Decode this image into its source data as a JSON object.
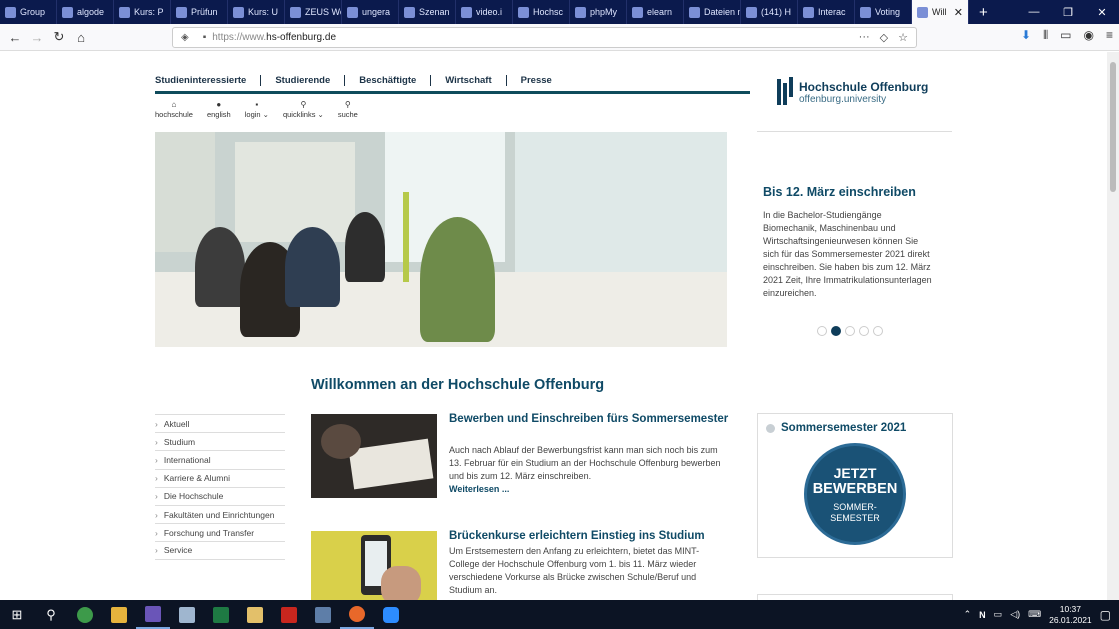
{
  "browser": {
    "tabs": [
      {
        "label": "Group"
      },
      {
        "label": "algode"
      },
      {
        "label": "Kurs: P"
      },
      {
        "label": "Prüfun"
      },
      {
        "label": "Kurs: U"
      },
      {
        "label": "ZEUS Web"
      },
      {
        "label": "ungera"
      },
      {
        "label": "Szenan"
      },
      {
        "label": "video.i"
      },
      {
        "label": "Hochsc"
      },
      {
        "label": "phpMy"
      },
      {
        "label": "elearn"
      },
      {
        "label": "Dateien m"
      },
      {
        "label": "(141) H"
      },
      {
        "label": "Interac"
      },
      {
        "label": "Voting"
      },
      {
        "label": "Will"
      }
    ],
    "new_tab": "+",
    "url_prefix": "https://www.",
    "url_host": "hs-offenburg.de"
  },
  "site": {
    "topnav": [
      "Studieninteressierte",
      "Studierende",
      "Beschäftigte",
      "Wirtschaft",
      "Presse"
    ],
    "subnav": [
      {
        "icon": "home-icon",
        "glyph": "⌂",
        "label": "hochschule"
      },
      {
        "icon": "globe-icon",
        "glyph": "●",
        "label": "english"
      },
      {
        "icon": "lock-icon",
        "glyph": "▪",
        "label": "login ⌄"
      },
      {
        "icon": "link-icon",
        "glyph": "⚲",
        "label": "quicklinks ⌄"
      },
      {
        "icon": "search-icon",
        "glyph": "⚲",
        "label": "suche"
      }
    ],
    "logo_line1": "Hochschule Offenburg",
    "logo_line2": "offenburg.university"
  },
  "slider": {
    "title": "Bis 12. März einschreiben",
    "text": "In die Bachelor-Studiengänge Biomechanik, Maschinenbau und Wirtschaftsingenieurwesen können Sie sich für das Sommersemester 2021 direkt einschreiben. Sie haben bis zum 12. März 2021 Zeit, Ihre Immatrikulationsunterlagen einzureichen.",
    "active_slide": 2,
    "slide_count": 5
  },
  "welcome_heading": "Willkommen an der Hochschule Offenburg",
  "sidenav": [
    "Aktuell",
    "Studium",
    "International",
    "Karriere & Alumni",
    "Die Hochschule",
    "Fakultäten und Einrichtungen",
    "Forschung und Transfer",
    "Service"
  ],
  "news": [
    {
      "title": "Bewerben und Einschreiben fürs Sommerse­mester",
      "text": "Auch nach Ablauf der Bewerbungsfrist kann man sich noch bis zum 13. Februar für ein Studium an der Hochschule Offenburg bewerben und bis zum 12. März einschreiben.",
      "link": "Weiterlesen ..."
    },
    {
      "title": "Brückenkurse erleichtern Einstieg ins Studium",
      "text": "Um Erstsemestern den Anfang zu erleichtern, bietet das MINT-College der Hochschule Offenburg vom 1. bis 11. März wieder verschiedene Vorkurse als Brücke zwischen Schule/Beruf und Studium an."
    }
  ],
  "promo": {
    "title": "Sommersemester 2021",
    "badge_line1": "JETZT",
    "badge_line2": "BEWERBEN",
    "badge_line3": "SOMMER-",
    "badge_line4": "SEMESTER"
  },
  "taskbar": {
    "time": "10:37",
    "date": "26.01.2021"
  },
  "colors": {
    "brand": "#0f4a66",
    "tabbar": "#0b1a4d"
  }
}
